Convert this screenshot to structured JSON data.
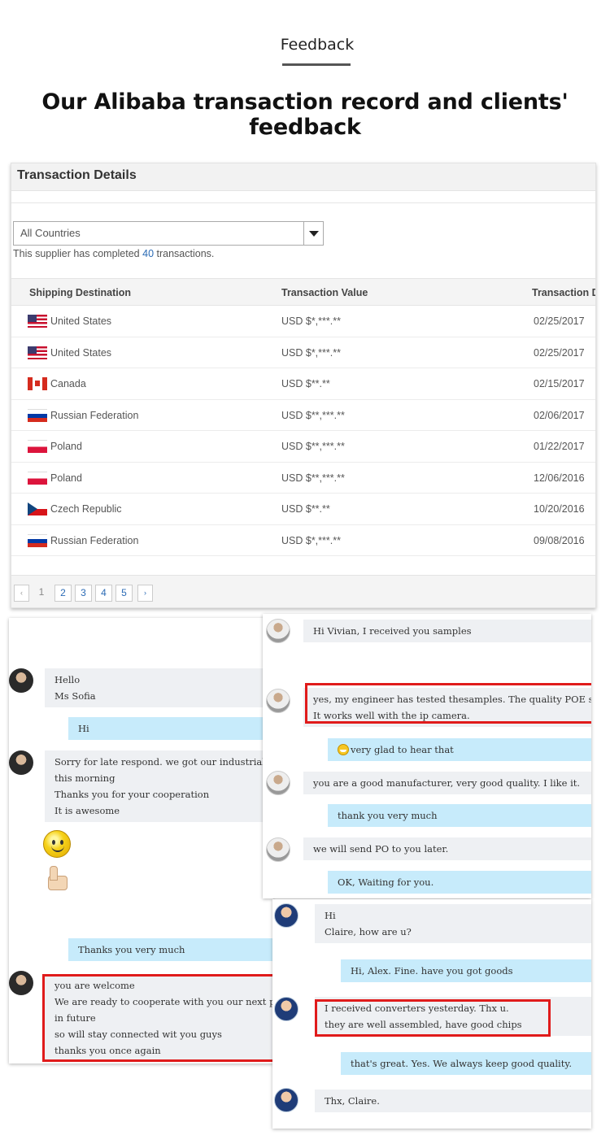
{
  "header": {
    "section_label": "Feedback",
    "headline": "Our Alibaba transaction record and clients' feedback"
  },
  "transactions": {
    "title": "Transaction Details",
    "filter": {
      "selected": "All Countries"
    },
    "summary": {
      "prefix": "This supplier has completed",
      "count": "40",
      "suffix": "transactions."
    },
    "columns": [
      "Shipping Destination",
      "Transaction Value",
      "Transaction D"
    ],
    "rows": [
      {
        "flag": "us-flag-icon",
        "country": "United States",
        "value": "USD $*,***.**",
        "date": "02/25/2017"
      },
      {
        "flag": "us-flag-icon",
        "country": "United States",
        "value": "USD $*,***.**",
        "date": "02/25/2017"
      },
      {
        "flag": "ca-flag-icon",
        "country": "Canada",
        "value": "USD $**.**",
        "date": "02/15/2017"
      },
      {
        "flag": "ru-flag-icon",
        "country": "Russian Federation",
        "value": "USD $**,***.**",
        "date": "02/06/2017"
      },
      {
        "flag": "pl-flag-icon",
        "country": "Poland",
        "value": "USD $**,***.**",
        "date": "01/22/2017"
      },
      {
        "flag": "pl-flag-icon",
        "country": "Poland",
        "value": "USD $**,***.**",
        "date": "12/06/2016"
      },
      {
        "flag": "cz-flag-icon",
        "country": "Czech Republic",
        "value": "USD $**.**",
        "date": "10/20/2016"
      },
      {
        "flag": "ru-flag-icon",
        "country": "Russian Federation",
        "value": "USD $*,***.**",
        "date": "09/08/2016"
      }
    ],
    "pagination": {
      "prev": "‹",
      "current": "1",
      "pages": [
        "2",
        "3",
        "4",
        "5"
      ],
      "next": "›"
    }
  },
  "chat_left": {
    "m1": [
      "Hello",
      "Ms Sofia"
    ],
    "m2": "Hi",
    "m3": [
      "Sorry for late respond. we got our industrial switch",
      "this morning",
      "Thanks you for your cooperation",
      "It is awesome"
    ],
    "m4": "Thanks you very much",
    "m5": [
      "you are welcome",
      "We are ready to cooperate with you our next projects",
      "in future",
      "so will stay connected wit you guys",
      "thanks you once again"
    ]
  },
  "chat_top_right": {
    "m1": "Hi Vivian, I received you samples",
    "m2": [
      "yes, my engineer has tested thesamples. The quality POE switch is exc",
      "It works well with the ip camera."
    ],
    "m3": "very glad to hear that",
    "m4": "you are a good manufacturer, very good quality. I like it.",
    "m5": "thank you very much",
    "m6": "we will send PO to you later.",
    "m7": "OK, Waiting for you."
  },
  "chat_bottom_right": {
    "m1": [
      "Hi",
      "Claire, how are u?"
    ],
    "m2": "Hi, Alex. Fine. have you got goods",
    "m3": [
      "I received converters yesterday. Thx u.",
      "they are well assembled, have good chips"
    ],
    "m4": "that's great. Yes. We always keep good quality.",
    "m5": "Thx, Claire."
  },
  "colors": {
    "accent_link": "#2b6bb5",
    "highlight_box": "#e01b1b",
    "outgoing_bubble": "#c7ebfb",
    "incoming_bubble": "#eef0f3"
  }
}
